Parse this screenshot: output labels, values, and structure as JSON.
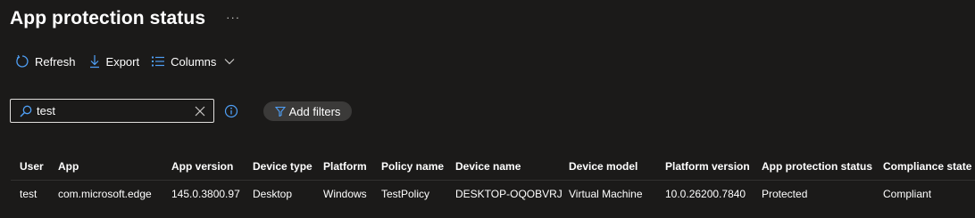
{
  "header": {
    "title": "App protection status",
    "more": "···"
  },
  "toolbar": {
    "refresh": "Refresh",
    "export": "Export",
    "columns": "Columns"
  },
  "search": {
    "value": "test",
    "placeholder": ""
  },
  "filters": {
    "add_label": "Add filters"
  },
  "colors": {
    "background": "#1b1a19",
    "accent": "#4f9ff5",
    "pill": "#3b3a39"
  },
  "table": {
    "columns": [
      "User",
      "App",
      "App version",
      "Device type",
      "Platform",
      "Policy name",
      "Device name",
      "Device model",
      "Platform version",
      "App protection status",
      "Compliance state"
    ],
    "rows": [
      [
        "test",
        "com.microsoft.edge",
        "145.0.3800.97",
        "Desktop",
        "Windows",
        "TestPolicy",
        "DESKTOP-OQOBVRJ",
        "Virtual Machine",
        "10.0.26200.7840",
        "Protected",
        "Compliant"
      ]
    ]
  }
}
